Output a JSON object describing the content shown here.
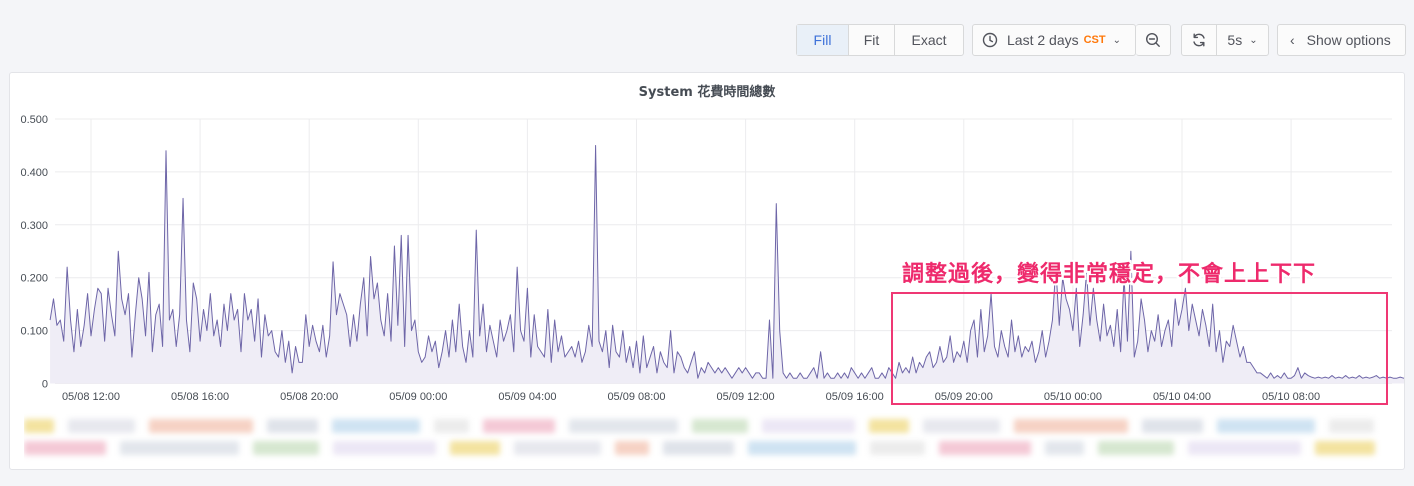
{
  "toolbar": {
    "fill_label": "Fill",
    "fit_label": "Fit",
    "exact_label": "Exact",
    "time_range_label": "Last 2 days",
    "timezone_label": "CST",
    "refresh_interval_label": "5s",
    "show_options_label": "Show options",
    "icons": [
      "clock-icon",
      "zoom-out-icon",
      "refresh-icon",
      "chevron-down-icon",
      "chevron-left-icon"
    ]
  },
  "annotation": {
    "text": "調整過後，變得非常穩定，不會上上下下"
  },
  "colors": {
    "series_line": "#6e66a8",
    "series_fill": "#efedf6",
    "annotation": "#ee2a6c",
    "accent": "#3d71d9"
  },
  "chart_data": {
    "type": "area",
    "title": "System 花費時間總數",
    "xlabel": "",
    "ylabel": "",
    "x_start": "05/08 10:30",
    "x_step_minutes": 7.5,
    "x_ticks": [
      "05/08 12:00",
      "05/08 16:00",
      "05/08 20:00",
      "05/09 00:00",
      "05/09 04:00",
      "05/09 08:00",
      "05/09 12:00",
      "05/09 16:00",
      "05/09 20:00",
      "05/10 00:00",
      "05/10 04:00",
      "05/10 08:00"
    ],
    "y_ticks": [
      "0",
      "0.100",
      "0.200",
      "0.300",
      "0.400",
      "0.500"
    ],
    "ylim": [
      0,
      0.5
    ],
    "grid": true,
    "legend": "bottom",
    "series": [
      {
        "values": [
          0.12,
          0.16,
          0.11,
          0.12,
          0.08,
          0.22,
          0.12,
          0.06,
          0.14,
          0.07,
          0.11,
          0.17,
          0.09,
          0.14,
          0.18,
          0.17,
          0.08,
          0.18,
          0.13,
          0.09,
          0.25,
          0.16,
          0.13,
          0.17,
          0.05,
          0.13,
          0.2,
          0.16,
          0.09,
          0.21,
          0.06,
          0.13,
          0.15,
          0.07,
          0.44,
          0.12,
          0.14,
          0.07,
          0.13,
          0.35,
          0.12,
          0.06,
          0.19,
          0.16,
          0.08,
          0.14,
          0.1,
          0.17,
          0.09,
          0.12,
          0.07,
          0.15,
          0.1,
          0.17,
          0.12,
          0.14,
          0.06,
          0.17,
          0.12,
          0.14,
          0.08,
          0.16,
          0.05,
          0.13,
          0.09,
          0.1,
          0.06,
          0.05,
          0.1,
          0.04,
          0.08,
          0.02,
          0.07,
          0.04,
          0.04,
          0.13,
          0.07,
          0.11,
          0.08,
          0.06,
          0.11,
          0.05,
          0.09,
          0.23,
          0.13,
          0.17,
          0.15,
          0.13,
          0.07,
          0.13,
          0.08,
          0.15,
          0.2,
          0.09,
          0.24,
          0.16,
          0.19,
          0.12,
          0.09,
          0.17,
          0.08,
          0.26,
          0.11,
          0.28,
          0.07,
          0.28,
          0.1,
          0.12,
          0.06,
          0.04,
          0.05,
          0.09,
          0.06,
          0.08,
          0.03,
          0.06,
          0.1,
          0.05,
          0.12,
          0.06,
          0.15,
          0.07,
          0.04,
          0.1,
          0.05,
          0.29,
          0.09,
          0.15,
          0.06,
          0.11,
          0.08,
          0.05,
          0.12,
          0.08,
          0.1,
          0.13,
          0.06,
          0.22,
          0.1,
          0.08,
          0.18,
          0.05,
          0.13,
          0.07,
          0.06,
          0.05,
          0.14,
          0.04,
          0.12,
          0.06,
          0.09,
          0.05,
          0.06,
          0.07,
          0.05,
          0.08,
          0.04,
          0.06,
          0.11,
          0.07,
          0.45,
          0.08,
          0.06,
          0.1,
          0.03,
          0.11,
          0.06,
          0.05,
          0.1,
          0.04,
          0.07,
          0.03,
          0.08,
          0.02,
          0.09,
          0.03,
          0.05,
          0.07,
          0.02,
          0.06,
          0.04,
          0.03,
          0.1,
          0.02,
          0.06,
          0.05,
          0.03,
          0.02,
          0.04,
          0.06,
          0.01,
          0.03,
          0.02,
          0.04,
          0.03,
          0.02,
          0.03,
          0.02,
          0.03,
          0.02,
          0.01,
          0.02,
          0.03,
          0.02,
          0.03,
          0.02,
          0.01,
          0.02,
          0.02,
          0.01,
          0.01,
          0.12,
          0.01,
          0.34,
          0.1,
          0.02,
          0.01,
          0.02,
          0.01,
          0.01,
          0.02,
          0.01,
          0.01,
          0.02,
          0.03,
          0.01,
          0.06,
          0.01,
          0.02,
          0.01,
          0.01,
          0.02,
          0.01,
          0.02,
          0.01,
          0.03,
          0.02,
          0.01,
          0.02,
          0.01,
          0.02,
          0.03,
          0.01,
          0.01,
          0.02,
          0.01,
          0.03,
          0.02,
          0.01,
          0.04,
          0.02,
          0.03,
          0.02,
          0.05,
          0.02,
          0.04,
          0.03,
          0.05,
          0.06,
          0.03,
          0.04,
          0.07,
          0.04,
          0.05,
          0.09,
          0.04,
          0.06,
          0.05,
          0.08,
          0.04,
          0.1,
          0.12,
          0.05,
          0.14,
          0.06,
          0.09,
          0.17,
          0.07,
          0.05,
          0.1,
          0.07,
          0.05,
          0.12,
          0.06,
          0.09,
          0.05,
          0.07,
          0.06,
          0.08,
          0.04,
          0.06,
          0.1,
          0.05,
          0.08,
          0.12,
          0.22,
          0.11,
          0.2,
          0.16,
          0.14,
          0.1,
          0.18,
          0.07,
          0.13,
          0.21,
          0.11,
          0.18,
          0.12,
          0.08,
          0.15,
          0.09,
          0.11,
          0.07,
          0.14,
          0.06,
          0.2,
          0.08,
          0.25,
          0.05,
          0.08,
          0.16,
          0.12,
          0.06,
          0.1,
          0.08,
          0.13,
          0.07,
          0.1,
          0.12,
          0.07,
          0.16,
          0.11,
          0.14,
          0.18,
          0.1,
          0.15,
          0.12,
          0.09,
          0.14,
          0.11,
          0.07,
          0.15,
          0.06,
          0.1,
          0.04,
          0.08,
          0.07,
          0.11,
          0.08,
          0.05,
          0.07,
          0.04,
          0.04,
          0.03,
          0.02,
          0.02,
          0.015,
          0.01,
          0.02,
          0.01,
          0.015,
          0.01,
          0.02,
          0.01,
          0.01,
          0.015,
          0.03,
          0.01,
          0.02,
          0.015,
          0.012,
          0.01,
          0.012,
          0.01,
          0.012,
          0.01,
          0.015,
          0.01,
          0.012,
          0.01,
          0.015,
          0.01,
          0.012,
          0.01,
          0.015,
          0.01,
          0.012,
          0.01,
          0.012,
          0.015,
          0.01,
          0.012,
          0.01,
          0.012,
          0.01,
          0.01,
          0.012,
          0.01,
          0.012,
          0.01,
          0.01,
          0.012,
          0.01,
          0.008,
          0.01,
          0.012,
          0.01,
          0.01,
          0.008,
          0.01,
          0.012,
          0.01,
          0.008,
          0.01,
          0.01,
          0.008,
          0.012,
          0.008,
          0.01,
          0.008,
          0.01,
          0.008,
          0.01,
          0.01,
          0.008,
          0.01,
          0.008,
          0.008,
          0.01,
          0.008,
          0.008,
          0.01,
          0.008,
          0.008,
          0.008,
          0.008,
          0.01,
          0.008,
          0.008,
          0.008,
          0.008,
          0.01,
          0.008,
          0.008,
          0.008,
          0.008,
          0.008,
          0.01,
          0.008,
          0.008,
          0.07,
          0.05,
          0.07,
          0.008,
          0.006,
          0.007,
          0.008,
          0.006,
          0.008,
          0.007,
          0.008,
          0.006,
          0.008,
          0.007,
          0.008,
          0.007,
          0.008,
          0.006,
          0.008,
          0.007,
          0.012,
          0.007,
          0.008,
          0.007,
          0.008,
          0.009,
          0.007,
          0.008,
          0.009,
          0.01,
          0.008,
          0.009,
          0.011,
          0.01,
          0.012,
          0.01,
          0.015,
          0.01,
          0.012,
          0.01,
          0.012,
          0.01,
          0.012,
          0.01
        ]
      }
    ]
  }
}
